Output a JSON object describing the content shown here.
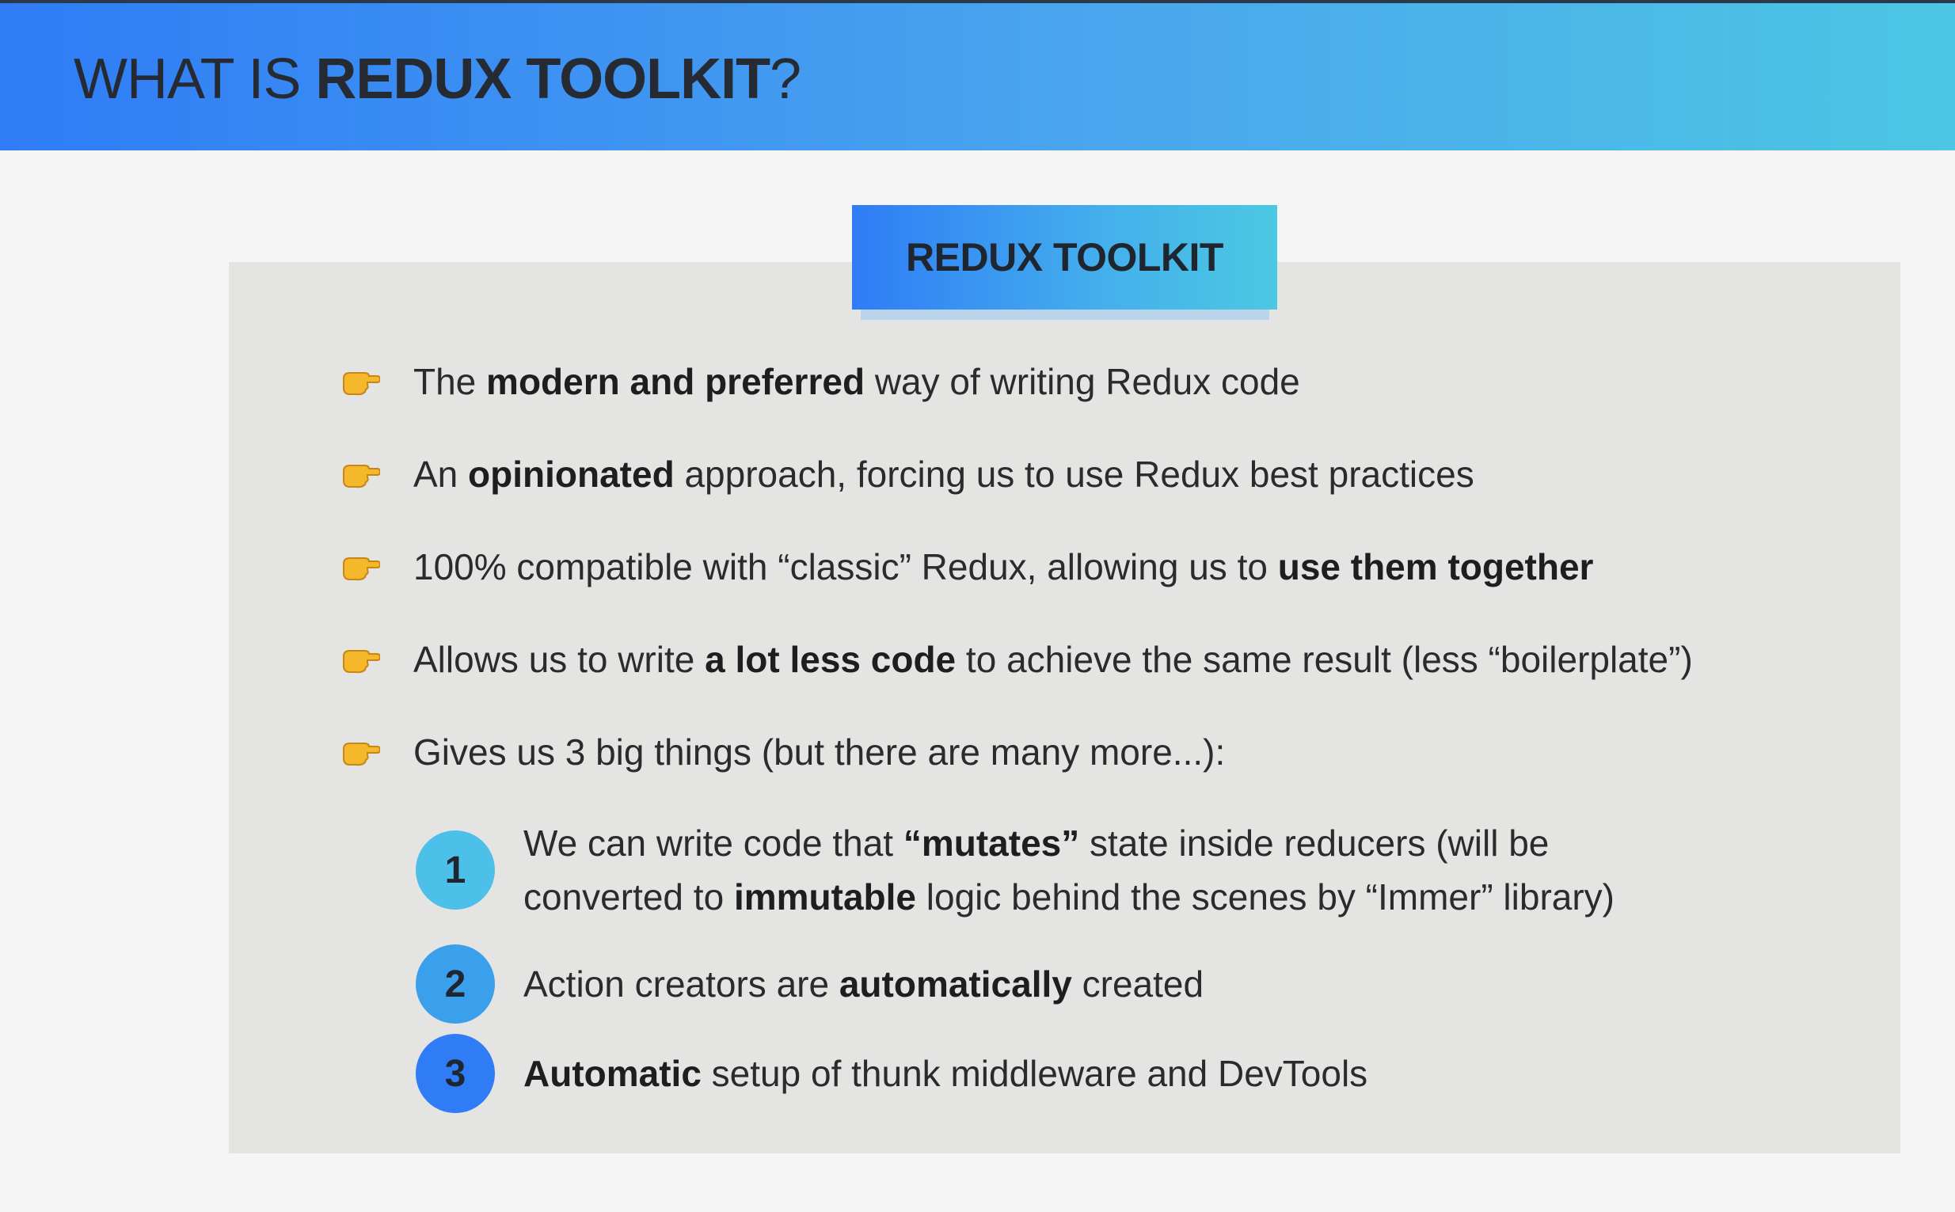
{
  "header": {
    "title_prefix": "WHAT IS ",
    "title_bold": "REDUX TOOLKIT",
    "title_suffix": "?"
  },
  "badge": {
    "label": "REDUX TOOLKIT"
  },
  "colors": {
    "accent_blue": "#2f7cf6",
    "accent_cyan": "#4cc6e4",
    "hand": "#f5b82a"
  },
  "bullets": [
    {
      "icon": "pointing-hand-icon",
      "parts": [
        "The ",
        "modern and preferred",
        " way of writing Redux code"
      ]
    },
    {
      "icon": "pointing-hand-icon",
      "parts": [
        "An ",
        "opinionated",
        " approach, forcing us to use Redux best practices"
      ]
    },
    {
      "icon": "pointing-hand-icon",
      "parts": [
        "100% compatible with “classic” Redux, allowing us to ",
        "use them together",
        ""
      ]
    },
    {
      "icon": "pointing-hand-icon",
      "parts": [
        "Allows us to write ",
        "a lot less code",
        " to achieve the same result (less “boilerplate”)"
      ]
    },
    {
      "icon": "pointing-hand-icon",
      "parts": [
        "Gives us 3 big things (but there are many more...):",
        "",
        ""
      ]
    }
  ],
  "numbered": [
    {
      "number": "1",
      "color": "#4cc0e8",
      "line1_parts": [
        "We can write code that ",
        "“mutates”",
        " state inside reducers (will be"
      ],
      "line2_parts": [
        "converted to ",
        "immutable",
        " logic behind the scenes by “Immer” library)"
      ]
    },
    {
      "number": "2",
      "color": "#3aa0ec",
      "parts": [
        "Action creators are ",
        "automatically",
        " created"
      ]
    },
    {
      "number": "3",
      "color": "#2f7cf6",
      "parts": [
        "",
        "Automatic",
        " setup of thunk middleware and DevTools"
      ]
    }
  ]
}
